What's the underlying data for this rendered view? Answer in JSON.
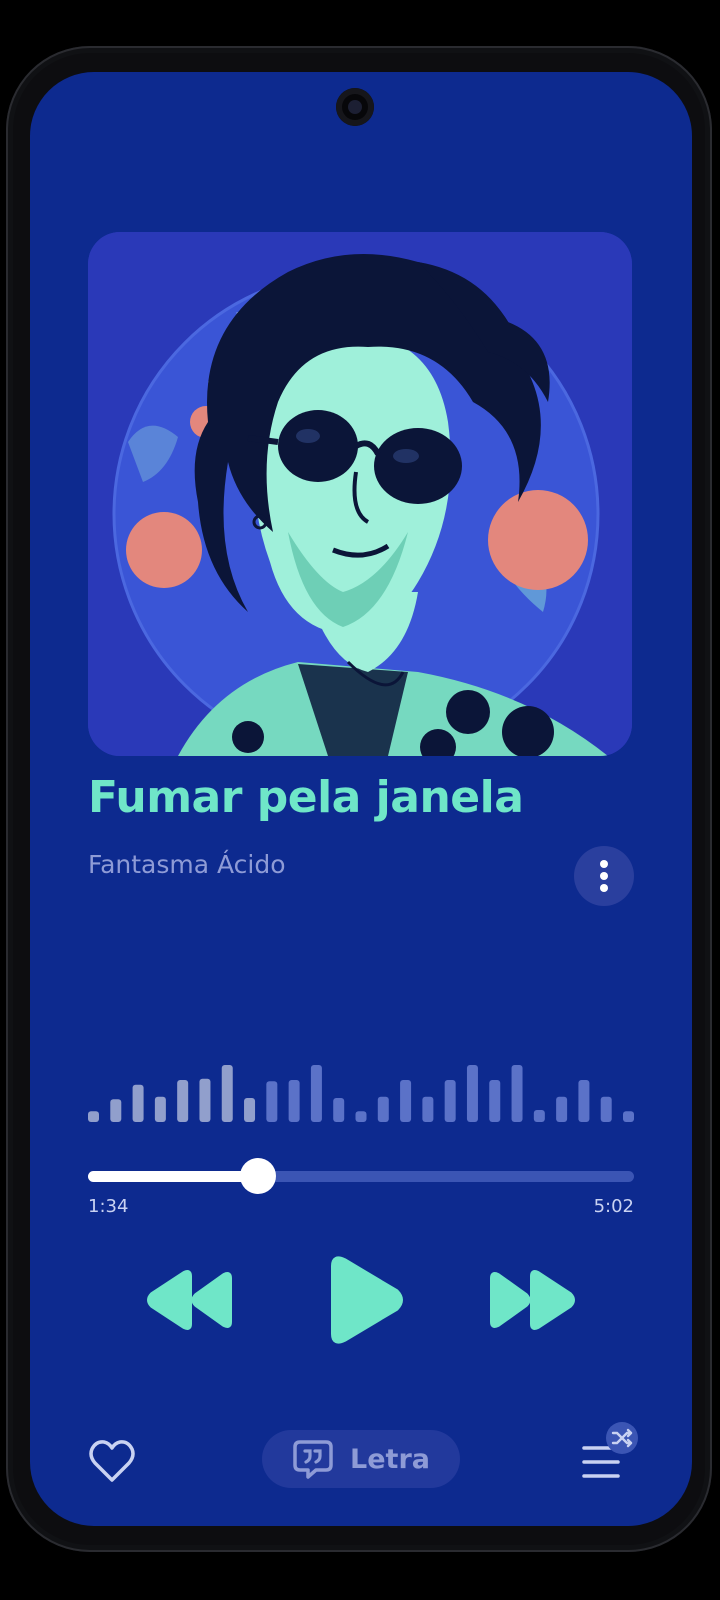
{
  "song": {
    "title": "Fumar pela janela",
    "artist": "Fantasma Ácido",
    "album_art": "illustrated-portrait-with-sunglasses"
  },
  "playback": {
    "elapsed": "1:34",
    "total": "5:02",
    "progress": 0.311,
    "state": "paused",
    "waveform": [
      0.18,
      0.38,
      0.62,
      0.42,
      0.7,
      0.72,
      0.95,
      0.4,
      0.68,
      0.7,
      0.95,
      0.4,
      0.18,
      0.42,
      0.7,
      0.42,
      0.7,
      0.95,
      0.7,
      0.95,
      0.2,
      0.42,
      0.7,
      0.42,
      0.18
    ]
  },
  "controls": {
    "rewind_icon": "rewind-icon",
    "play_icon": "play-icon",
    "fast_forward_icon": "fast-forward-icon"
  },
  "bottom_bar": {
    "like_icon": "heart-icon",
    "lyrics_label": "Letra",
    "lyrics_icon": "quote-bubble-icon",
    "queue_icon": "queue-icon",
    "shuffle_icon": "shuffle-icon"
  },
  "colors": {
    "background": "#0d2a8f",
    "accent": "#6fe6c8",
    "muted_text": "#8e9bd6",
    "waveform_played": "#ffffff",
    "waveform_unplayed": "#5b72c8"
  }
}
